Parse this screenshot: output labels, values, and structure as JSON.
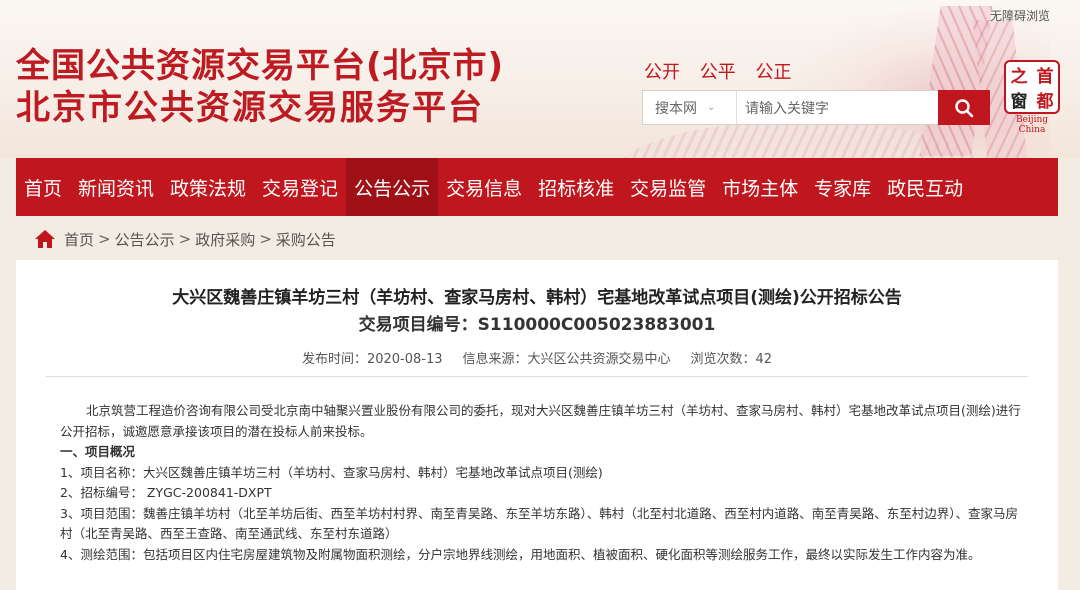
{
  "header": {
    "accessible_link": "无障碍浏览",
    "title_line1": "全国公共资源交易平台(北京市)",
    "title_line2": "北京市公共资源交易服务平台",
    "slogans": [
      "公开",
      "公平",
      "公正"
    ],
    "search": {
      "scope_label": "搜本网",
      "placeholder": "请输入关键字"
    },
    "logo": {
      "chars": [
        "之",
        "首",
        "窗",
        "都"
      ],
      "caption": "Beijing China"
    }
  },
  "nav": {
    "items": [
      "首页",
      "新闻资讯",
      "政策法规",
      "交易登记",
      "公告公示",
      "交易信息",
      "招标核准",
      "交易监管",
      "市场主体",
      "专家库",
      "政民互动"
    ],
    "active_index": 4
  },
  "breadcrumb": [
    "首页",
    "公告公示",
    "政府采购",
    "采购公告"
  ],
  "article": {
    "title": "大兴区魏善庄镇羊坊三村（羊坊村、查家马房村、韩村）宅基地改革试点项目(测绘)公开招标公告",
    "project_code": "交易项目编号：S110000C005023883001",
    "meta": {
      "publish_time": "发布时间：2020-08-13",
      "source": "信息来源：大兴区公共资源交易中心",
      "views": "浏览次数：42"
    },
    "intro": "北京筑营工程造价咨询有限公司受北京南中轴聚兴置业股份有限公司的委托，现对大兴区魏善庄镇羊坊三村（羊坊村、查家马房村、韩村）宅基地改革试点项目(测绘)进行公开招标，诚邀愿意承接该项目的潜在投标人前来投标。",
    "section_heading": "一、项目概况",
    "items": [
      "1、项目名称：大兴区魏善庄镇羊坊三村（羊坊村、查家马房村、韩村）宅基地改革试点项目(测绘)",
      "2、招标编号： ZYGC-200841-DXPT",
      "3、项目范围：魏善庄镇羊坊村（北至羊坊后街、西至羊坊村村界、南至青吴路、东至羊坊东路）、韩村（北至村北道路、西至村内道路、南至青吴路、东至村边界）、查家马房村（北至青吴路、西至王查路、南至通武线、东至村东道路）",
      "4、测绘范围：包括项目区内住宅房屋建筑物及附属物面积测绘，分户宗地界线测绘，用地面积、植被面积、硬化面积等测绘服务工作，最终以实际发生工作内容为准。"
    ]
  }
}
